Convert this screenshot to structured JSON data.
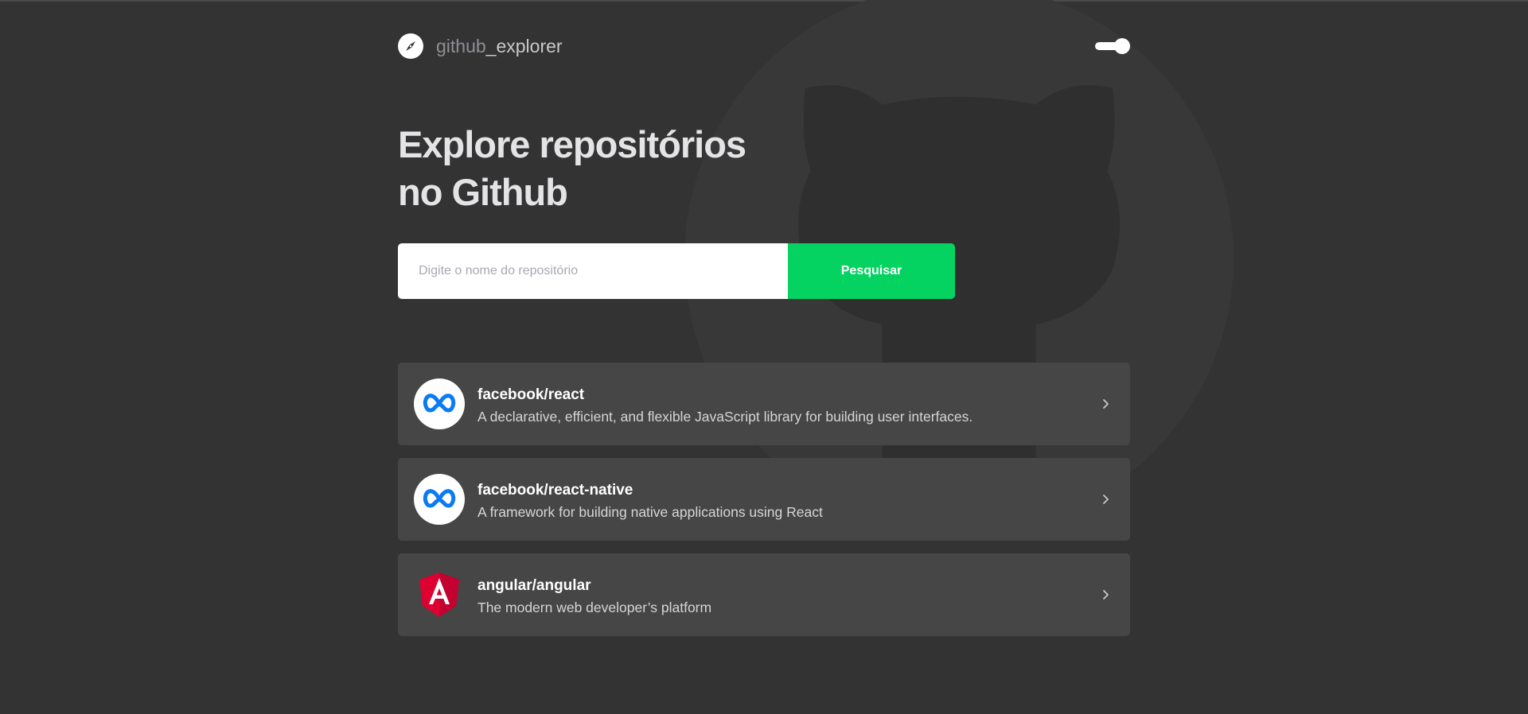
{
  "header": {
    "brand_part1": "github",
    "brand_part2": "_explorer",
    "logo_icon": "compass-icon",
    "theme_toggle_icon": "toggle-switch-icon"
  },
  "hero": {
    "line1": "Explore repositórios",
    "line2": "no Github"
  },
  "search": {
    "placeholder": "Digite o nome do repositório",
    "value": "",
    "button_label": "Pesquisar"
  },
  "repositories": [
    {
      "name": "facebook/react",
      "description": "A declarative, efficient, and flexible JavaScript library for building user interfaces.",
      "avatar_icon": "meta-logo-icon"
    },
    {
      "name": "facebook/react-native",
      "description": "A framework for building native applications using React",
      "avatar_icon": "meta-logo-icon"
    },
    {
      "name": "angular/angular",
      "description": "The modern web developer’s platform",
      "avatar_icon": "angular-logo-icon"
    }
  ],
  "colors": {
    "background": "#333334",
    "card": "#464647",
    "accent_green": "#04d361",
    "meta_blue": "#0a7bf2",
    "angular_red": "#dd0031"
  }
}
